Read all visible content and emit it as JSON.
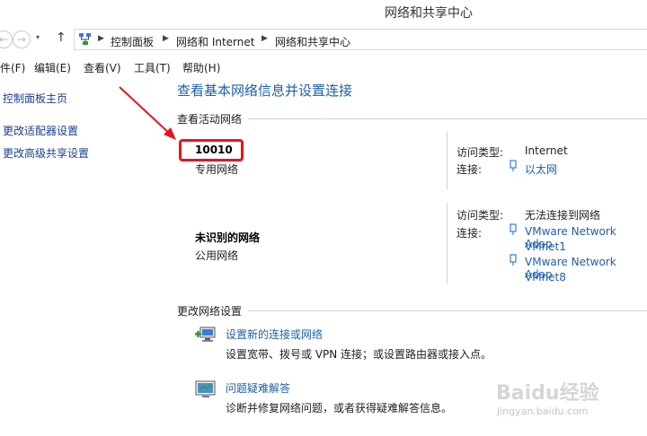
{
  "window": {
    "title": "网络和共享中心"
  },
  "address_bar": {
    "crumbs": [
      "控制面板",
      "网络和 Internet",
      "网络和共享中心"
    ]
  },
  "menu": [
    "件(F)",
    "编辑(E)",
    "查看(V)",
    "工具(T)",
    "帮助(H)"
  ],
  "left_pane": {
    "links": [
      "控制面板主页",
      "更改适配器设置",
      "更改高级共享设置"
    ]
  },
  "main": {
    "heading": "查看基本网络信息并设置连接",
    "active_networks_label": "查看活动网络",
    "networks": [
      {
        "name": "10010",
        "type": "专用网络",
        "access_type_label": "访问类型:",
        "access_type": "Internet",
        "connections_label": "连接:",
        "connections": [
          "以太网"
        ]
      },
      {
        "name": "未识别的网络",
        "type": "公用网络",
        "access_type_label": "访问类型:",
        "access_type": "无法连接到网络",
        "connections_label": "连接:",
        "connections": [
          "VMware Network Adap",
          "VMnet1",
          "VMware Network Adap",
          "VMnet8"
        ]
      }
    ],
    "change_settings_label": "更改网络设置",
    "tasks": [
      {
        "link": "设置新的连接或网络",
        "desc": "设置宽带、拨号或 VPN 连接；或设置路由器或接入点。"
      },
      {
        "link": "问题疑难解答",
        "desc": "诊断并修复网络问题，或者获得疑难解答信息。"
      }
    ]
  },
  "watermark": {
    "brand": "Baidu经验",
    "url": "jingyan.baidu.com"
  },
  "colors": {
    "link": "#1e5fa8",
    "highlight": "#e8141b",
    "annotation_arrow": "#e8141b"
  }
}
